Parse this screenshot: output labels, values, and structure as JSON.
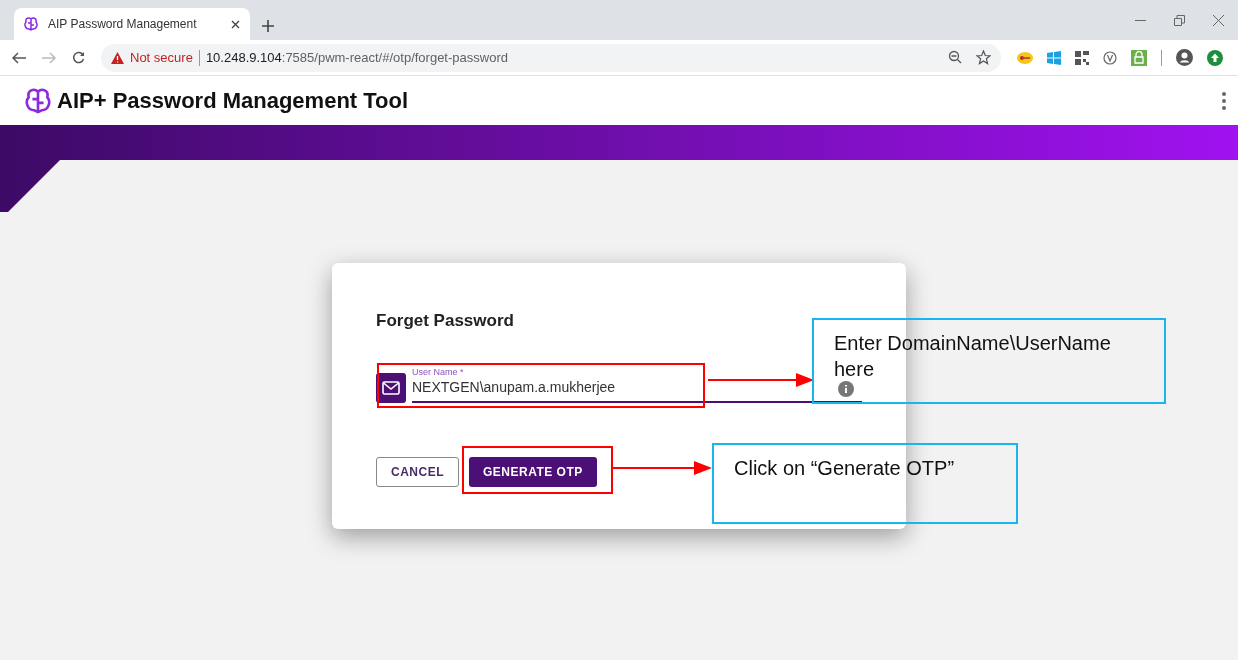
{
  "browser": {
    "tab": {
      "title": "AIP Password Management"
    },
    "address": {
      "security": "Not secure",
      "host": "10.248.9.104",
      "path": ":7585/pwm-react/#/otp/forget-password"
    }
  },
  "app": {
    "title": "AIP+ Password Management Tool"
  },
  "dialog": {
    "title": "Forget Password",
    "field": {
      "label": "User Name *",
      "value": "NEXTGEN\\anupam.a.mukherjee"
    },
    "buttons": [
      {
        "label": "CANCEL",
        "kind": "outlined"
      },
      {
        "label": "GENERATE OTP",
        "kind": "filled"
      }
    ]
  },
  "annotations": [
    {
      "text": "Enter DomainName\\UserName here"
    },
    {
      "text": "Click on “Generate OTP”"
    }
  ]
}
